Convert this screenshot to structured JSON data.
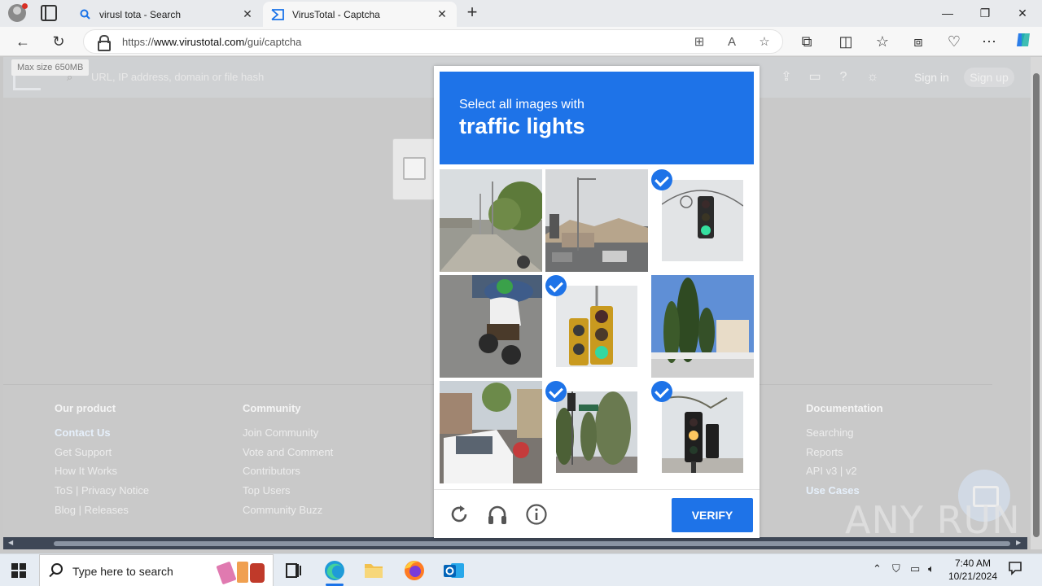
{
  "browser": {
    "tabs": [
      {
        "title": "virusl tota - Search",
        "active": false,
        "icon": "search-icon"
      },
      {
        "title": "VirusTotal - Captcha",
        "active": true,
        "icon": "virustotal-icon"
      }
    ],
    "address": {
      "prefix": "https://",
      "domain": "www.virustotal.com",
      "path": "/gui/captcha"
    }
  },
  "page": {
    "max_size_tooltip": "Max size 650MB",
    "search_placeholder": "URL, IP address, domain or file hash",
    "sign_in": "Sign in",
    "sign_up": "Sign up",
    "footer": {
      "our_product": {
        "title": "Our product",
        "links": [
          "Contact Us",
          "Get Support",
          "How It Works",
          "ToS | Privacy Notice",
          "Blog | Releases"
        ]
      },
      "community": {
        "title": "Community",
        "links": [
          "Join Community",
          "Vote and Comment",
          "Contributors",
          "Top Users",
          "Community Buzz"
        ]
      },
      "documentation": {
        "title": "Documentation",
        "links": [
          "Searching",
          "Reports",
          "API v3 | v2",
          "Use Cases"
        ]
      }
    },
    "watermark": "ANY RUN"
  },
  "captcha": {
    "prompt": "Select all images with",
    "target": "traffic lights",
    "tiles": [
      {
        "name": "street-trees",
        "selected": false
      },
      {
        "name": "street-intersection",
        "selected": false
      },
      {
        "name": "traffic-light-green",
        "selected": true
      },
      {
        "name": "motorcyclist",
        "selected": false
      },
      {
        "name": "double-traffic-light",
        "selected": true
      },
      {
        "name": "cypress-trees",
        "selected": false
      },
      {
        "name": "street-van",
        "selected": false
      },
      {
        "name": "street-sign-trees",
        "selected": true
      },
      {
        "name": "traffic-light-yellow",
        "selected": true
      }
    ],
    "verify_label": "VERIFY",
    "accent": "#1e73e8"
  },
  "taskbar": {
    "search_placeholder": "Type here to search",
    "time": "7:40 AM",
    "date": "10/21/2024"
  }
}
